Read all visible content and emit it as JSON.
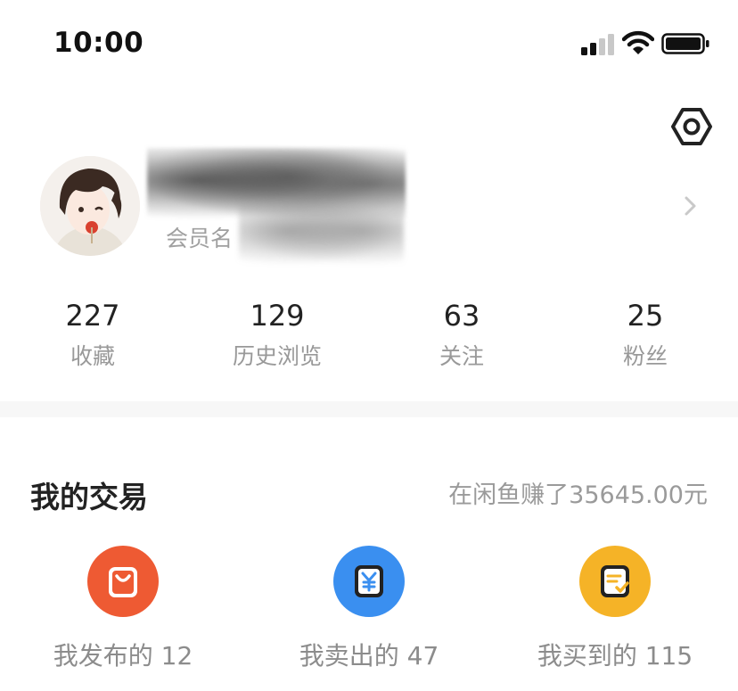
{
  "status_bar": {
    "time": "10:00"
  },
  "profile": {
    "member_label": "会员名"
  },
  "stats": [
    {
      "value": "227",
      "label": "收藏"
    },
    {
      "value": "129",
      "label": "历史浏览"
    },
    {
      "value": "63",
      "label": "关注"
    },
    {
      "value": "25",
      "label": "粉丝"
    }
  ],
  "trades": {
    "title": "我的交易",
    "earned": "在闲鱼赚了35645.00元",
    "items": [
      {
        "label": "我发布的 12",
        "color": "#ee5a33",
        "icon": "shopping-bag-icon"
      },
      {
        "label": "我卖出的 47",
        "color": "#3a8ff0",
        "icon": "yuan-icon"
      },
      {
        "label": "我买到的 115",
        "color": "#f5b327",
        "icon": "receipt-check-icon"
      }
    ]
  }
}
